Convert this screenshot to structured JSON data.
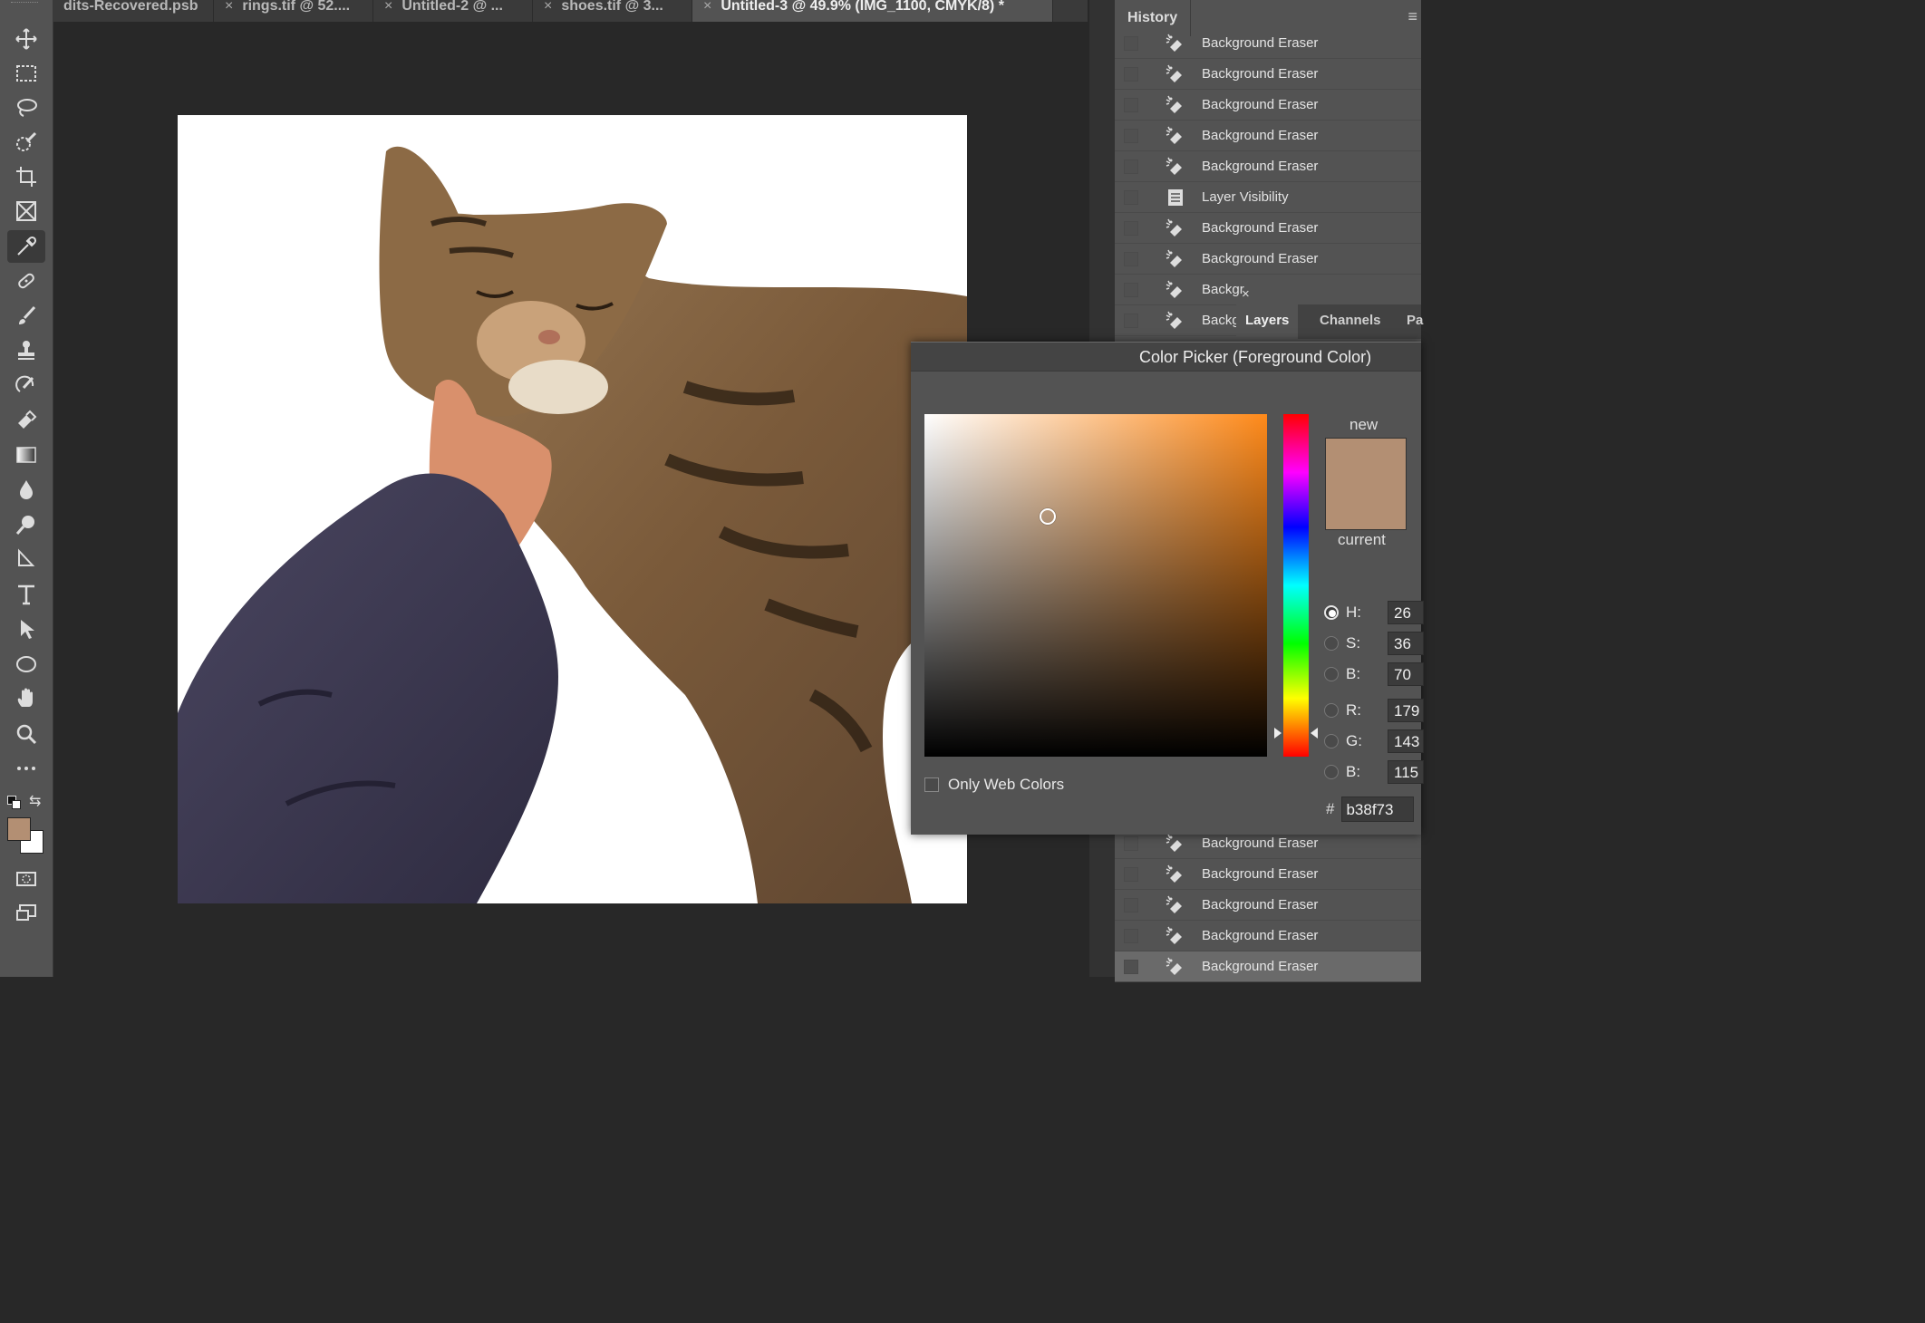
{
  "tabs": [
    {
      "label": "dits-Recovered.psb",
      "active": false
    },
    {
      "label": "rings.tif @ 52....",
      "active": false
    },
    {
      "label": "Untitled-2 @ ...",
      "active": false
    },
    {
      "label": "shoes.tif @ 3...",
      "active": false
    },
    {
      "label": "Untitled-3 @ 49.9% (IMG_1100, CMYK/8) *",
      "active": true
    }
  ],
  "tab_overflow": "»",
  "tools": [
    {
      "name": "move-tool",
      "icon": "move-icon"
    },
    {
      "name": "marquee-tool",
      "icon": "rectangle-marquee-icon"
    },
    {
      "name": "lasso-tool",
      "icon": "lasso-icon"
    },
    {
      "name": "quick-selection-tool",
      "icon": "quick-selection-icon"
    },
    {
      "name": "crop-tool",
      "icon": "crop-icon"
    },
    {
      "name": "frame-tool",
      "icon": "frame-icon"
    },
    {
      "name": "eyedropper-tool",
      "icon": "eyedropper-icon"
    },
    {
      "name": "healing-brush-tool",
      "icon": "bandage-icon"
    },
    {
      "name": "brush-tool",
      "icon": "brush-icon"
    },
    {
      "name": "clone-stamp-tool",
      "icon": "stamp-icon"
    },
    {
      "name": "history-brush-tool",
      "icon": "history-brush-icon"
    },
    {
      "name": "eraser-tool",
      "icon": "eraser-icon"
    },
    {
      "name": "gradient-tool",
      "icon": "gradient-icon"
    },
    {
      "name": "blur-tool",
      "icon": "drop-icon"
    },
    {
      "name": "dodge-tool",
      "icon": "dodge-icon"
    },
    {
      "name": "pen-tool",
      "icon": "pen-icon"
    },
    {
      "name": "type-tool",
      "icon": "type-icon"
    },
    {
      "name": "path-selection-tool",
      "icon": "arrow-icon"
    },
    {
      "name": "ellipse-tool",
      "icon": "ellipse-icon"
    },
    {
      "name": "hand-tool",
      "icon": "hand-icon"
    },
    {
      "name": "zoom-tool",
      "icon": "zoom-icon"
    },
    {
      "name": "more-tools",
      "icon": "more-icon"
    }
  ],
  "history": {
    "title": "History",
    "menu_icon": "panel-menu-icon",
    "top_items": [
      "Background Eraser",
      "Background Eraser",
      "Background Eraser",
      "Background Eraser",
      "Background Eraser",
      "Layer Visibility",
      "Background Eraser",
      "Background Eraser",
      "Backgr",
      "Backgr"
    ],
    "bottom_items": [
      "Background Eraser",
      "Background Eraser",
      "Background Eraser",
      "Background Eraser",
      "Background Eraser"
    ]
  },
  "layers_panel": {
    "close": "×",
    "tabs": [
      "Layers",
      "Channels",
      "Pa"
    ]
  },
  "color_picker": {
    "title": "Color Picker (Foreground Color)",
    "new_label": "new",
    "current_label": "current",
    "new_color": "#b38f73",
    "current_color": "#b38f73",
    "hue_color": "#ff8a1a",
    "saturation": 0.36,
    "brightness": 0.7,
    "hue_position": 0.93,
    "fields": [
      {
        "label": "H:",
        "value": "26",
        "selected": true
      },
      {
        "label": "S:",
        "value": "36",
        "selected": false
      },
      {
        "label": "B:",
        "value": "70",
        "selected": false
      },
      {
        "label": "R:",
        "value": "179",
        "selected": false
      },
      {
        "label": "G:",
        "value": "143",
        "selected": false
      },
      {
        "label": "B:",
        "value": "115",
        "selected": false
      }
    ],
    "hex_symbol": "#",
    "hex": "b38f73",
    "only_web_colors": "Only Web Colors"
  },
  "colors": {
    "foreground": "#b38f73",
    "background": "#ffffff"
  }
}
